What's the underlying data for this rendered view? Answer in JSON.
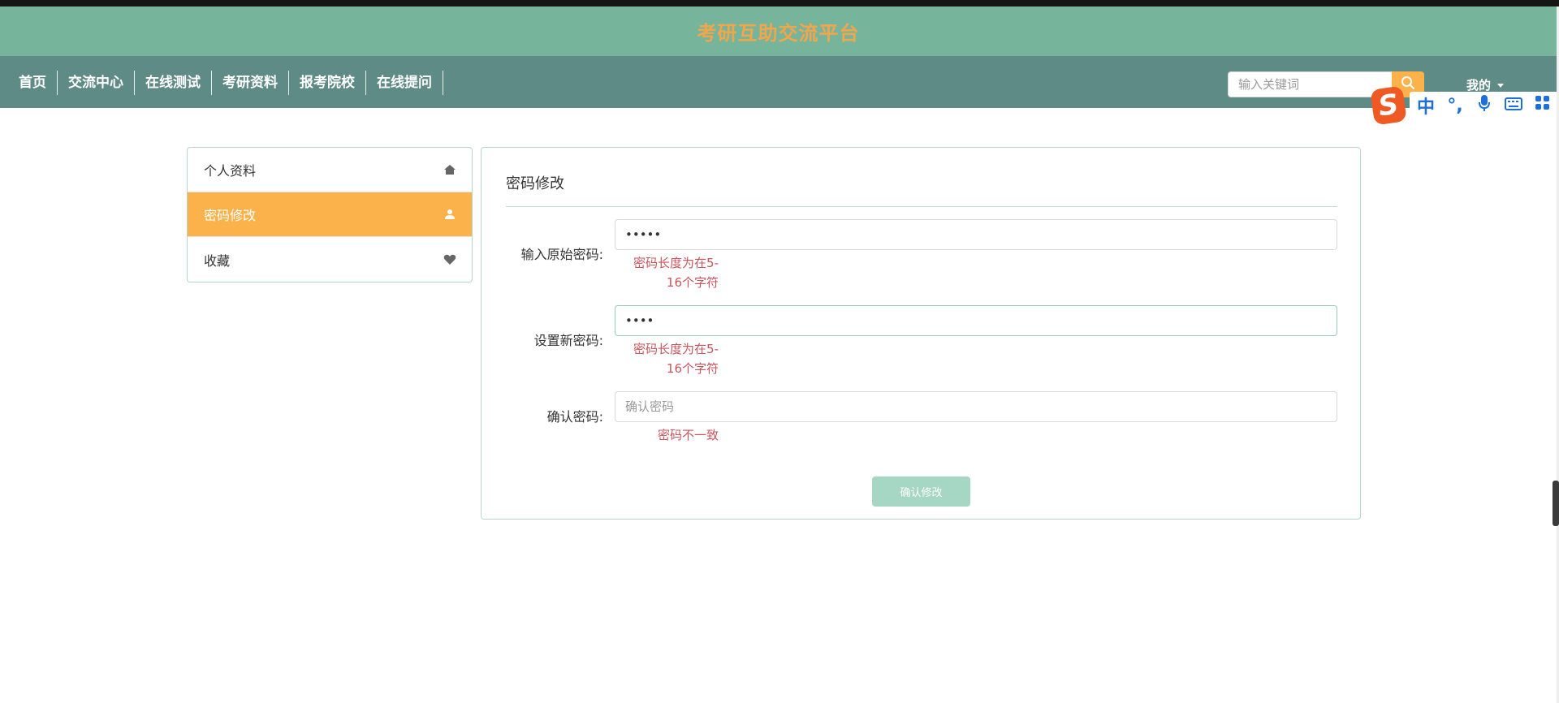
{
  "header": {
    "site_title": "考研互助交流平台"
  },
  "nav": {
    "items": [
      {
        "label": "首页",
        "name": "nav-item-home"
      },
      {
        "label": "交流中心",
        "name": "nav-item-exchange-center"
      },
      {
        "label": "在线测试",
        "name": "nav-item-online-test"
      },
      {
        "label": "考研资料",
        "name": "nav-item-exam-materials"
      },
      {
        "label": "报考院校",
        "name": "nav-item-target-schools"
      },
      {
        "label": "在线提问",
        "name": "nav-item-online-questions"
      }
    ],
    "search_placeholder": "输入关键词",
    "search_icon": "search-icon",
    "mine_label": "我的"
  },
  "ime_toolbar": {
    "logo": "S",
    "tools": [
      "中",
      "°,",
      "mic-icon",
      "keyboard-icon",
      "grid-icon"
    ]
  },
  "sidebar": {
    "items": [
      {
        "label": "个人资料",
        "icon": "home-icon",
        "active": false
      },
      {
        "label": "密码修改",
        "icon": "user-icon",
        "active": true
      },
      {
        "label": "收藏",
        "icon": "heart-icon",
        "active": false
      }
    ]
  },
  "form": {
    "title": "密码修改",
    "old_password": {
      "label": "输入原始密码:",
      "value": "•••••",
      "error_line1": "密码长度为在5-",
      "error_line2": "16个字符"
    },
    "new_password": {
      "label": "设置新密码:",
      "value": "••••",
      "error_line1": "密码长度为在5-",
      "error_line2": "16个字符"
    },
    "confirm_password": {
      "label": "确认密码:",
      "placeholder": "确认密码",
      "error": "密码不一致"
    },
    "submit_label": "确认修改"
  },
  "colors": {
    "title_bar": "#76b59b",
    "nav_bar": "#5f8b87",
    "accent": "#fbb24a",
    "title_text": "#f1a64b",
    "error_text": "#c9545c",
    "submit_button": "#a6d6c4"
  }
}
